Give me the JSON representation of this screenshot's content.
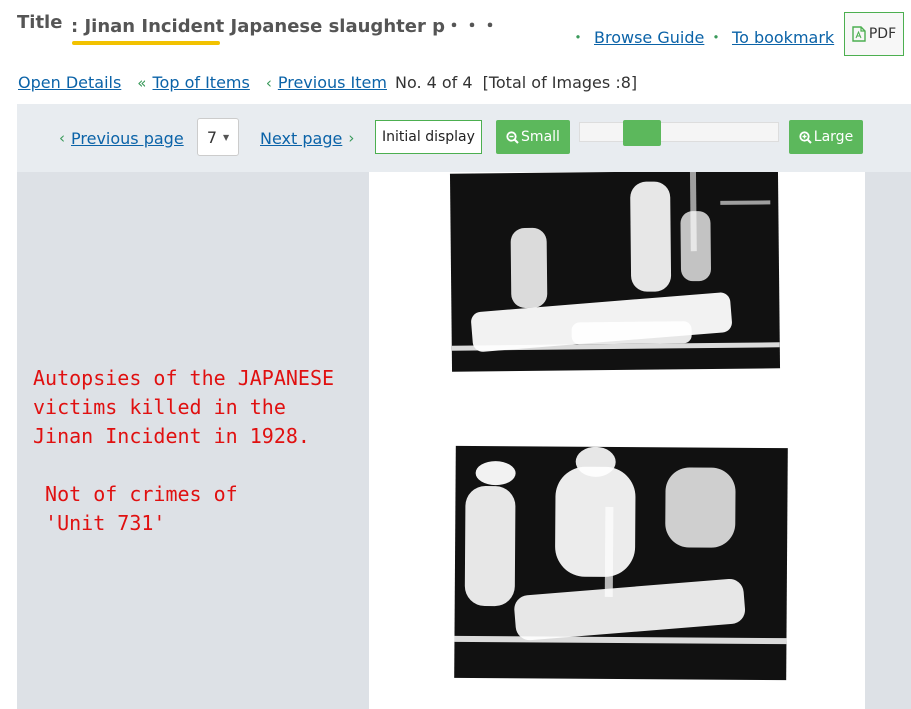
{
  "header": {
    "title_label": "Title",
    "title_text": ": Jinan Incident Japanese slaughter p・・・",
    "browse_guide": "Browse Guide",
    "to_bookmark": "To bookmark",
    "pdf_label": "PDF"
  },
  "nav": {
    "open_details": "Open Details",
    "top_of_items": "Top of Items",
    "previous_item": "Previous Item",
    "position": "No. 4 of 4",
    "total_images": "[Total of Images :8]"
  },
  "toolbar": {
    "previous_page": "Previous page",
    "page_select_value": "7",
    "next_page": "Next page",
    "initial_display": "Initial display",
    "small": "Small",
    "large": "Large",
    "zoom_level_fraction": 0.27
  },
  "annotation": {
    "text": "Autopsies of the JAPANESE\nvictims killed in the\nJinan Incident in 1928.\n\n Not of crimes of\n 'Unit 731'"
  },
  "colors": {
    "accent_green": "#5cb85c",
    "link_blue": "#0b63a8",
    "title_underline": "#f2c200",
    "annotation_red": "#e01010"
  }
}
